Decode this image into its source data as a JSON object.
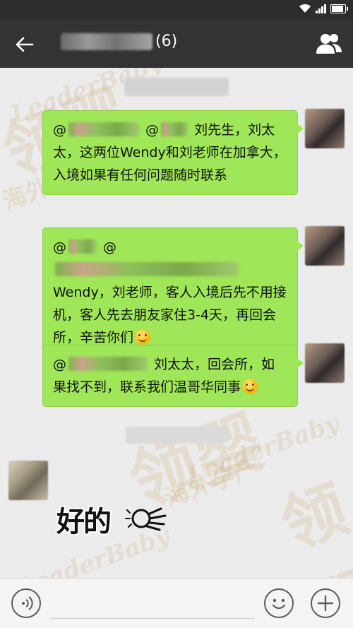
{
  "status": {
    "battery_level": 0.9
  },
  "header": {
    "member_count": "(6)",
    "back_icon": "arrow-left-icon",
    "group_icon": "group-members-icon"
  },
  "messages": [
    {
      "prefix": "@",
      "mid": " @",
      "text": " 刘先生，刘太太，这两位Wendy和刘老师在加拿大，入境如果有任何问题随时联系"
    },
    {
      "prefix": "@",
      "mid": " @",
      "text": " Wendy，刘老师，客人入境后先不用接机，客人先去朋友家住3-4天，再回会所，辛苦你们",
      "emoji": "smile-emoji"
    },
    {
      "prefix": "@",
      "text": " 刘太太，回会所，如果找不到，联系我们温哥华同事",
      "emoji": "grin-emoji"
    }
  ],
  "sticker": {
    "text": "好的",
    "icon": "ok-hand-icon"
  },
  "watermark": {
    "brand_cn": "领婴",
    "brand_en": "LeaderBaby",
    "tagline": "海外孕产"
  },
  "inputbar": {
    "voice_icon": "voice-icon",
    "emoji_icon": "emoji-icon",
    "plus_icon": "plus-icon"
  }
}
